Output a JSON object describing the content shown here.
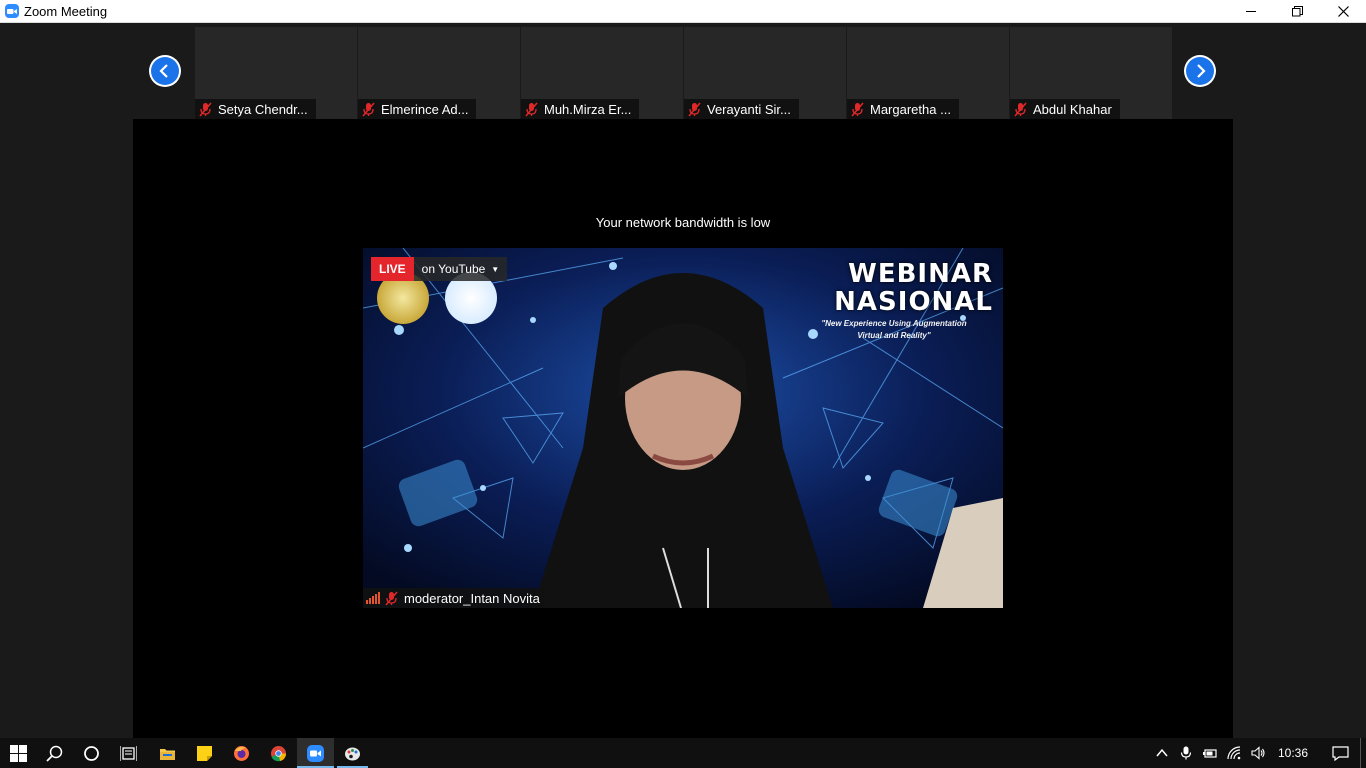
{
  "window": {
    "title": "Zoom Meeting"
  },
  "gallery": {
    "participants": [
      {
        "name": "Setya Chendr...",
        "muted": true
      },
      {
        "name": "Elmerince Ad...",
        "muted": true
      },
      {
        "name": "Muh.Mirza Er...",
        "muted": true
      },
      {
        "name": "Verayanti Sir...",
        "muted": true
      },
      {
        "name": "Margaretha ...",
        "muted": true
      },
      {
        "name": "Abdul Khahar",
        "muted": true
      }
    ]
  },
  "main": {
    "notice": "Your network bandwidth is low",
    "live": {
      "badge": "LIVE",
      "platform": "on YouTube"
    },
    "slide": {
      "title_line1": "WEBINAR",
      "title_line2": "NASIONAL",
      "subtitle": "\"New Experience Using Augmentation Virtual and Reality\""
    },
    "speaker": {
      "name": "moderator_Intan Novita",
      "muted": true
    }
  },
  "taskbar": {
    "apps": [
      "start-icon",
      "search-icon",
      "cortana-icon",
      "task-view-icon",
      "file-explorer-icon",
      "sticky-notes-icon",
      "firefox-icon",
      "chrome-icon",
      "zoom-icon",
      "paint-icon"
    ],
    "clock": "10:36"
  },
  "colors": {
    "accent": "#1a73e8",
    "live": "#e5252c",
    "muted_mic": "#e02828",
    "taskbar_indicator": "#76b9ed"
  }
}
